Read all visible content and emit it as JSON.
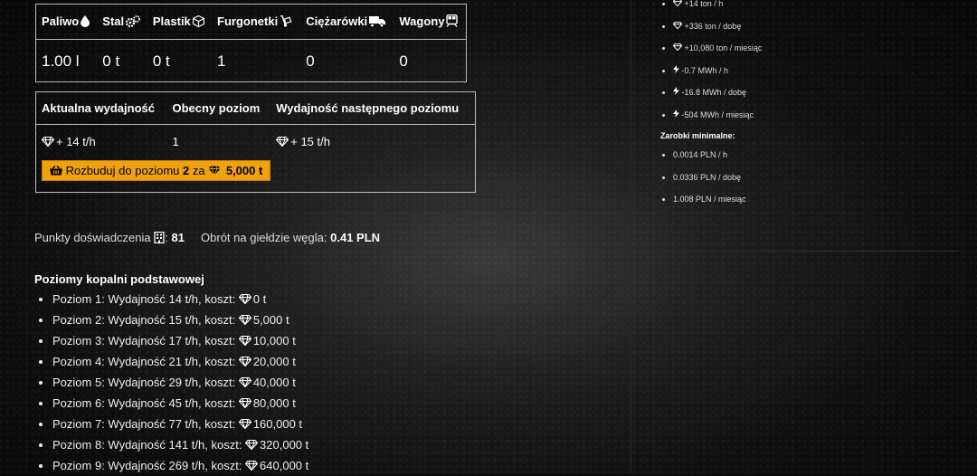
{
  "resources_table": {
    "headers": [
      "Paliwo",
      "Stal",
      "Plastik",
      "Furgonetki",
      "Ciężarówki",
      "Wagony"
    ],
    "header_icons": [
      "fuel-drop-icon",
      "gears-icon",
      "cube-icon",
      "hand-truck-icon",
      "truck-icon",
      "train-icon"
    ],
    "values": [
      "1.00 l",
      "0 t",
      "0 t",
      "1",
      "0",
      "0"
    ]
  },
  "production_table": {
    "headers": [
      "Aktualna wydajność",
      "Obecny poziom",
      "Wydajność następnego poziomu"
    ],
    "current_output": "+ 14 t/h",
    "current_level": "1",
    "next_output": "+ 15 t/h",
    "upgrade": {
      "prefix": "Rozbuduj do poziomu",
      "level": "2",
      "mid": "za",
      "cost": "5,000 t"
    }
  },
  "stats": {
    "xp_label": "Punkty doświadczenia",
    "xp_value": "81",
    "turnover_label": "Obrót na giełdzie węgla:",
    "turnover_value": "0.41 PLN"
  },
  "levels": {
    "title": "Poziomy kopalni podstawowej",
    "items": [
      {
        "text": "Poziom 1: Wydajność 14 t/h, koszt:",
        "cost": "0 t"
      },
      {
        "text": "Poziom 2: Wydajność 15 t/h, koszt:",
        "cost": "5,000 t"
      },
      {
        "text": "Poziom 3: Wydajność 17 t/h, koszt:",
        "cost": "10,000 t"
      },
      {
        "text": "Poziom 4: Wydajność 21 t/h, koszt:",
        "cost": "20,000 t"
      },
      {
        "text": "Poziom 5: Wydajność 29 t/h, koszt:",
        "cost": "40,000 t"
      },
      {
        "text": "Poziom 6: Wydajność 45 t/h, koszt:",
        "cost": "80,000 t"
      },
      {
        "text": "Poziom 7: Wydajność 77 t/h, koszt:",
        "cost": "160,000 t"
      },
      {
        "text": "Poziom 8: Wydajność 141 t/h, koszt:",
        "cost": "320,000 t"
      },
      {
        "text": "Poziom 9: Wydajność 269 t/h, koszt:",
        "cost": "640,000 t"
      }
    ]
  },
  "right_panel": {
    "production_items": [
      {
        "icon": "diamond-icon",
        "text": "+14 ton / h"
      },
      {
        "icon": "diamond-icon",
        "text": "+336 ton / dobę"
      },
      {
        "icon": "diamond-icon",
        "text": "+10,080 ton / miesiąc"
      },
      {
        "icon": "lightning-icon",
        "text": "-0.7 MWh / h"
      },
      {
        "icon": "lightning-icon",
        "text": "-16.8 MWh / dobę"
      },
      {
        "icon": "lightning-icon",
        "text": "-504 MWh / miesiąc"
      }
    ],
    "min_earnings_title": "Zarobki minimalne:",
    "min_earnings": [
      "0.0014 PLN / h",
      "0.0336 PLN / dobę",
      "1.008 PLN / miesiąc"
    ]
  },
  "colors": {
    "accent": "#f0a10f",
    "background": "#141414",
    "text": "#ffffff"
  }
}
